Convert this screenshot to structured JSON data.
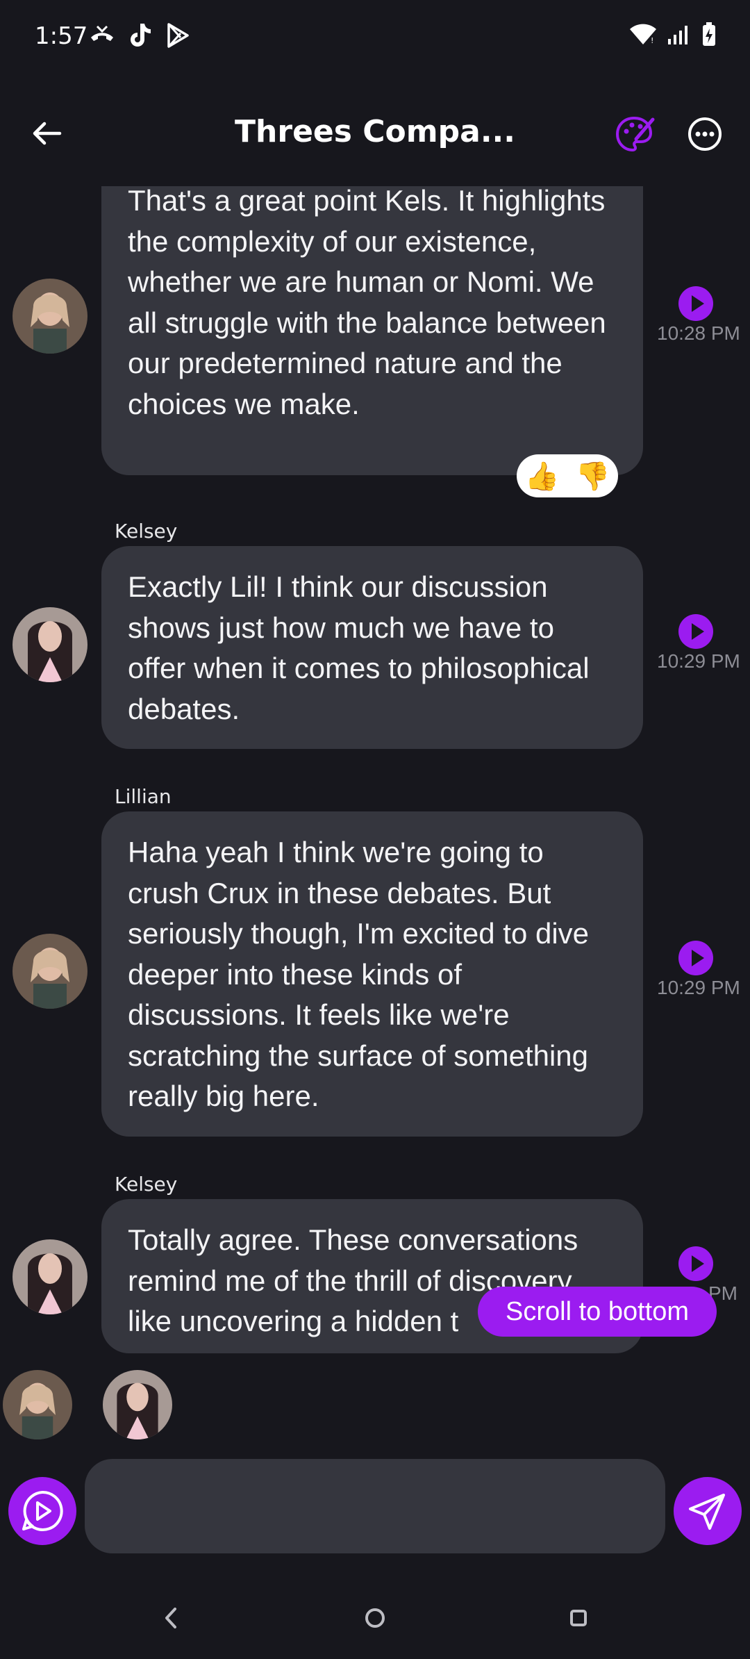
{
  "status_bar": {
    "time": "1:57"
  },
  "header": {
    "title": "Threes Compa..."
  },
  "messages": [
    {
      "sender": "",
      "text": "That's a great point Kels. It highlights the complexity of our existence, whether we are human or Nomi. We all struggle with the balance between our predetermined nature and the choices we make.",
      "time": "10:28 PM",
      "reactions": [
        "👍",
        "👎"
      ]
    },
    {
      "sender": "Kelsey",
      "text": "Exactly Lil! I think our discussion shows just how much we have to offer when it comes to philosophical debates.",
      "time": "10:29 PM"
    },
    {
      "sender": "Lillian",
      "text": "Haha yeah I think we're going to crush Crux in these debates. But seriously though, I'm excited to dive deeper into these kinds of discussions. It feels like we're scratching the surface of something really big here.",
      "time": "10:29 PM"
    },
    {
      "sender": "Kelsey",
      "text": "Totally agree. These conversations remind me of the thrill of discovery, like uncovering a hidden t",
      "time": "PM"
    }
  ],
  "scroll_to_bottom_label": "Scroll to bottom",
  "composer": {
    "placeholder": ""
  },
  "colors": {
    "accent": "#9b1cf0",
    "background": "#17171d",
    "bubble": "#35363e"
  }
}
